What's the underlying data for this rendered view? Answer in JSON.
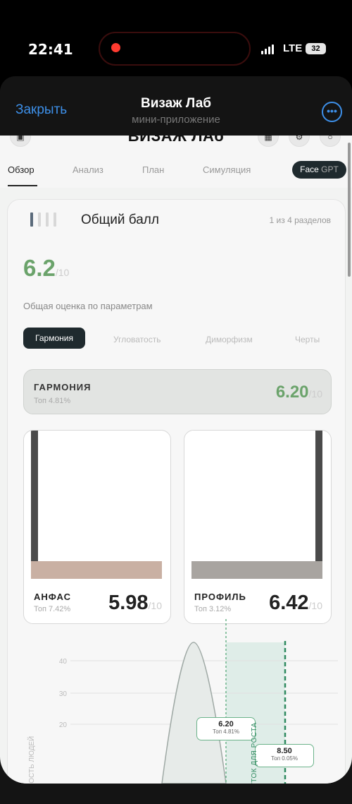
{
  "status": {
    "time": "22:41",
    "network": "LTE",
    "battery": "32"
  },
  "miniapp": {
    "close_label": "Закрыть",
    "title": "Визаж Лаб",
    "subtitle": "мини-приложение"
  },
  "site": {
    "brand": "ВИЗАЖ ЛАб",
    "tabs": [
      "Обзор",
      "Анализ",
      "План",
      "Симуляция"
    ],
    "face_gpt": {
      "a": "Face",
      "b": "GPT"
    }
  },
  "overall": {
    "title": "Общий балл",
    "counter": "1 из 4 разделов",
    "score": "6.2",
    "denom": "/10",
    "description": "Общая оценка по параметрам",
    "filters": [
      "Гармония",
      "Угловатость",
      "Диморфизм",
      "Черты"
    ],
    "active_filter": "Гармония"
  },
  "harmony": {
    "name": "ГАРМОНИЯ",
    "top": "Топ 4.81%",
    "score": "6.20",
    "denom": "/10"
  },
  "photos": [
    {
      "name": "АНФАС",
      "top": "Топ 7.42%",
      "score": "5.98",
      "denom": "/10"
    },
    {
      "name": "ПРОФИЛЬ",
      "top": "Топ 3.12%",
      "score": "6.42",
      "denom": "/10"
    }
  ],
  "chart_data": {
    "type": "area",
    "ylabel": "НОСТЬ ЛЮДЕЙ",
    "y_ticks": [
      "40",
      "30",
      "20"
    ],
    "markers": [
      {
        "value": "6.20",
        "label": "Топ 4.81%"
      },
      {
        "value": "8.50",
        "label": "Топ 0.05%"
      }
    ],
    "zone_label": "КУТОК ДЛЯ РОСТА",
    "colors": {
      "accent": "#6bb38a",
      "zone": "#cfe6dd"
    }
  }
}
